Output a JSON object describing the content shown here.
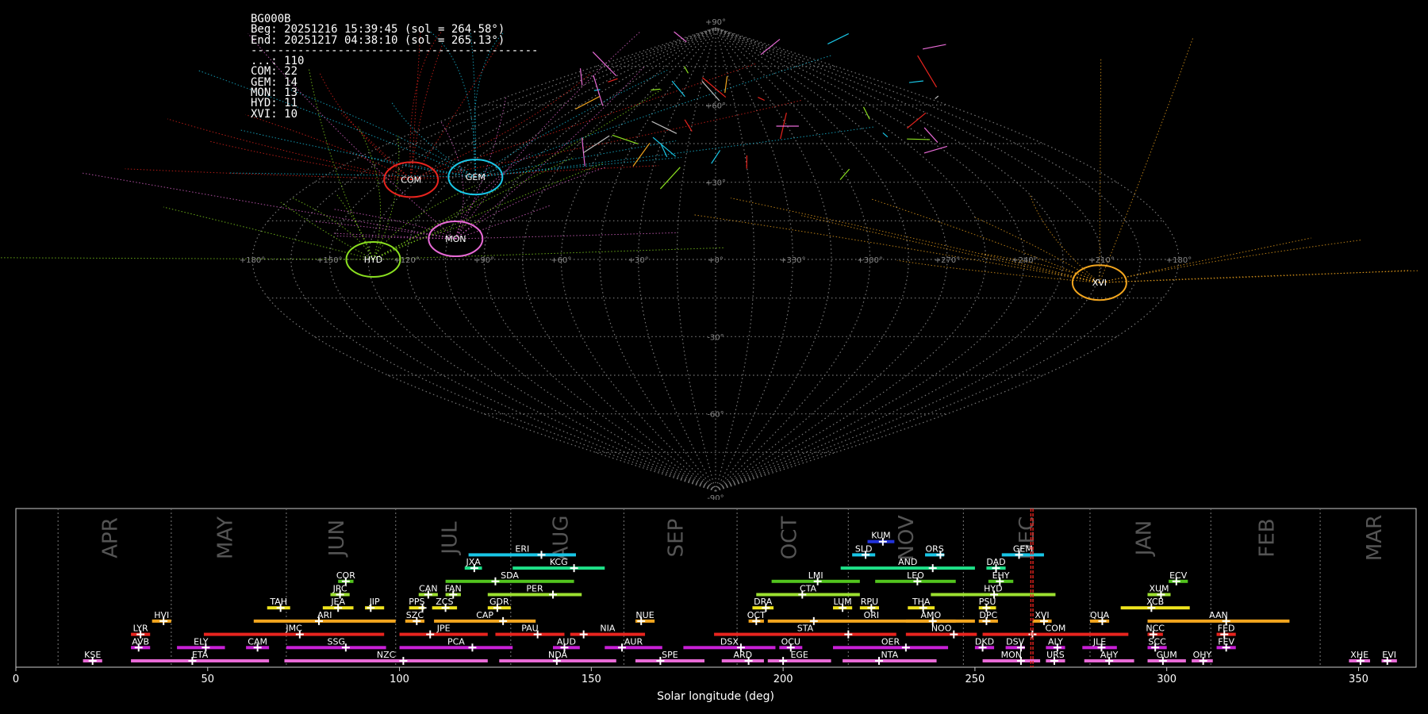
{
  "info": {
    "station": "BG000B",
    "begin": "Beg: 20251216 15:39:45 (sol = 264.58°)",
    "end": "End: 20251217 04:38:10 (sol = 265.13°)",
    "separator": "-------------------------------------------",
    "counts": [
      "...: 110",
      "COM: 22",
      "GEM: 14",
      "MON: 13",
      "HYD: 11",
      "XVI: 10"
    ]
  },
  "sky_map": {
    "projection": "sinusoidal",
    "center_lon": 0,
    "lon_ticks": [
      "+180°",
      "+150°",
      "+120°",
      "+90°",
      "+60°",
      "+30°",
      "+0°",
      "+330°",
      "+300°",
      "+270°",
      "+240°",
      "+210°",
      "+180°"
    ],
    "lat_ticks": [
      "+90°",
      "+60°",
      "+30°",
      "-30°",
      "-60°",
      "-90°"
    ],
    "radiants": [
      {
        "code": "COM",
        "lon": 138,
        "lat": 31,
        "color": "#e8241e"
      },
      {
        "code": "GEM",
        "lon": 110,
        "lat": 32,
        "color": "#19c6e6"
      },
      {
        "code": "MON",
        "lon": 102,
        "lat": 8,
        "color": "#e86ad6"
      },
      {
        "code": "HYD",
        "lon": 133,
        "lat": 0,
        "color": "#8be020"
      },
      {
        "code": "XVI",
        "lon": 209,
        "lat": -9,
        "color": "#f2a51e"
      }
    ]
  },
  "chart_data": {
    "type": "timeline",
    "xlabel": "Solar longitude (deg)",
    "xlim": [
      0,
      365
    ],
    "x_ticks": [
      0,
      50,
      100,
      150,
      200,
      250,
      300,
      350
    ],
    "current_sol": [
      264.58,
      265.13
    ],
    "month_boundaries": [
      11,
      40.5,
      70.5,
      99,
      129,
      158.5,
      188,
      217,
      247,
      280,
      311.5,
      340
    ],
    "months": [
      {
        "name": "APR",
        "x": 24.5
      },
      {
        "name": "MAY",
        "x": 54.5
      },
      {
        "name": "JUN",
        "x": 83.5
      },
      {
        "name": "JUL",
        "x": 113
      },
      {
        "name": "AUG",
        "x": 142
      },
      {
        "name": "SEP",
        "x": 172
      },
      {
        "name": "OCT",
        "x": 201.5
      },
      {
        "name": "NOV",
        "x": 232
      },
      {
        "name": "DEC",
        "x": 263.5
      },
      {
        "name": "JAN",
        "x": 294
      },
      {
        "name": "FEB",
        "x": 326
      },
      {
        "name": "MAR",
        "x": 354
      }
    ],
    "showers": [
      {
        "code": "KSE",
        "start": 17.5,
        "end": 22.5,
        "peak": 20,
        "row": 0,
        "color": "#e86ad6"
      },
      {
        "code": "ETA",
        "start": 30,
        "end": 66,
        "peak": 46,
        "row": 0,
        "color": "#e86ad6"
      },
      {
        "code": "NZC",
        "start": 70,
        "end": 123,
        "peak": 101,
        "row": 0,
        "color": "#e86ad6"
      },
      {
        "code": "NDA",
        "start": 126,
        "end": 156.5,
        "peak": 141,
        "row": 0,
        "color": "#e86ad6"
      },
      {
        "code": "SPE",
        "start": 161.5,
        "end": 179.5,
        "peak": 168,
        "row": 0,
        "color": "#e86ad6"
      },
      {
        "code": "ARD",
        "start": 184,
        "end": 195,
        "peak": 191,
        "row": 0,
        "color": "#e86ad6"
      },
      {
        "code": "EGE",
        "start": 196,
        "end": 212.5,
        "peak": 200,
        "row": 0,
        "color": "#e86ad6"
      },
      {
        "code": "NTA",
        "start": 215.5,
        "end": 240,
        "peak": 225,
        "row": 0,
        "color": "#e86ad6"
      },
      {
        "code": "MON",
        "start": 252,
        "end": 267,
        "peak": 262,
        "row": 0,
        "color": "#e86ad6"
      },
      {
        "code": "URS",
        "start": 268.5,
        "end": 273.5,
        "peak": 270.7,
        "row": 0,
        "color": "#e86ad6"
      },
      {
        "code": "AHY",
        "start": 278.5,
        "end": 291.5,
        "peak": 285,
        "row": 0,
        "color": "#e86ad6"
      },
      {
        "code": "GUM",
        "start": 295,
        "end": 305,
        "peak": 299,
        "row": 0,
        "color": "#e86ad6"
      },
      {
        "code": "OHY",
        "start": 306.5,
        "end": 312,
        "peak": 309.5,
        "row": 0,
        "color": "#e86ad6"
      },
      {
        "code": "XHE",
        "start": 347.5,
        "end": 353,
        "peak": 350.5,
        "row": 0,
        "color": "#e86ad6"
      },
      {
        "code": "EVI",
        "start": 356,
        "end": 360,
        "peak": 357.5,
        "row": 0,
        "color": "#e86ad6"
      },
      {
        "code": "AVB",
        "start": 30,
        "end": 35,
        "peak": 32,
        "row": 1,
        "color": "#c820d6"
      },
      {
        "code": "ELY",
        "start": 42,
        "end": 54.5,
        "peak": 49.5,
        "row": 1,
        "color": "#c820d6"
      },
      {
        "code": "CAM",
        "start": 60,
        "end": 66,
        "peak": 63,
        "row": 1,
        "color": "#c820d6"
      },
      {
        "code": "SSG",
        "start": 70.5,
        "end": 96.5,
        "peak": 86,
        "row": 1,
        "color": "#c820d6"
      },
      {
        "code": "PCA",
        "start": 100,
        "end": 129.5,
        "peak": 119,
        "row": 1,
        "color": "#c820d6"
      },
      {
        "code": "AUD",
        "start": 140,
        "end": 147,
        "peak": 143,
        "row": 1,
        "color": "#c820d6"
      },
      {
        "code": "AUR",
        "start": 153.5,
        "end": 168.5,
        "peak": 158,
        "row": 1,
        "color": "#c820d6"
      },
      {
        "code": "DSX",
        "start": 174,
        "end": 198,
        "peak": 189,
        "row": 1,
        "color": "#c820d6"
      },
      {
        "code": "OCU",
        "start": 199,
        "end": 205,
        "peak": 202,
        "row": 1,
        "color": "#c820d6"
      },
      {
        "code": "OER",
        "start": 213,
        "end": 243,
        "peak": 232,
        "row": 1,
        "color": "#c820d6"
      },
      {
        "code": "DKD",
        "start": 250,
        "end": 255,
        "peak": 252,
        "row": 1,
        "color": "#c820d6"
      },
      {
        "code": "DSV",
        "start": 258,
        "end": 263,
        "peak": 262,
        "row": 1,
        "color": "#c820d6"
      },
      {
        "code": "ALY",
        "start": 268.5,
        "end": 273.5,
        "peak": 271.5,
        "row": 1,
        "color": "#c820d6"
      },
      {
        "code": "JLE",
        "start": 278,
        "end": 287,
        "peak": 283,
        "row": 1,
        "color": "#c820d6"
      },
      {
        "code": "SCC",
        "start": 295,
        "end": 300,
        "peak": 297,
        "row": 1,
        "color": "#c820d6"
      },
      {
        "code": "FEV",
        "start": 313,
        "end": 318,
        "peak": 315.5,
        "row": 1,
        "color": "#c820d6"
      },
      {
        "code": "LYR",
        "start": 30,
        "end": 35,
        "peak": 32.5,
        "row": 2,
        "color": "#e8241e"
      },
      {
        "code": "JMC",
        "start": 49,
        "end": 96,
        "peak": 74,
        "row": 2,
        "color": "#e8241e"
      },
      {
        "code": "JPE",
        "start": 100,
        "end": 123,
        "peak": 108,
        "row": 2,
        "color": "#e8241e"
      },
      {
        "code": "PAU",
        "start": 125,
        "end": 143,
        "peak": 136,
        "row": 2,
        "color": "#e8241e"
      },
      {
        "code": "NIA",
        "start": 144.5,
        "end": 164,
        "peak": 148,
        "row": 2,
        "color": "#e8241e"
      },
      {
        "code": "STA",
        "start": 182,
        "end": 229.5,
        "peak": 217,
        "row": 2,
        "color": "#e8241e"
      },
      {
        "code": "NOO",
        "start": 232,
        "end": 250.5,
        "peak": 244.5,
        "row": 2,
        "color": "#e8241e"
      },
      {
        "code": "COM",
        "start": 252,
        "end": 290,
        "peak": 265,
        "row": 2,
        "color": "#e8241e"
      },
      {
        "code": "NCC",
        "start": 295,
        "end": 299,
        "peak": 296.5,
        "row": 2,
        "color": "#e8241e"
      },
      {
        "code": "FED",
        "start": 313,
        "end": 318,
        "peak": 315,
        "row": 2,
        "color": "#e8241e"
      },
      {
        "code": "HVI",
        "start": 35.5,
        "end": 40.5,
        "peak": 38.5,
        "row": 3,
        "color": "#f2a51e"
      },
      {
        "code": "ARI",
        "start": 62,
        "end": 99,
        "peak": 79,
        "row": 3,
        "color": "#f2a51e"
      },
      {
        "code": "SZC",
        "start": 101.5,
        "end": 106.5,
        "peak": 104.5,
        "row": 3,
        "color": "#f2a51e"
      },
      {
        "code": "CAP",
        "start": 109,
        "end": 135.5,
        "peak": 127,
        "row": 3,
        "color": "#f2a51e"
      },
      {
        "code": "NUE",
        "start": 161.5,
        "end": 166.5,
        "peak": 163,
        "row": 3,
        "color": "#f2a51e"
      },
      {
        "code": "OCT",
        "start": 191,
        "end": 195,
        "peak": 193,
        "row": 3,
        "color": "#f2a51e"
      },
      {
        "code": "ORI",
        "start": 196,
        "end": 250,
        "peak": 208,
        "row": 3,
        "color": "#f2a51e"
      },
      {
        "code": "AMO",
        "start": 232,
        "end": 245,
        "peak": 239,
        "row": 3,
        "color": "#f2a51e"
      },
      {
        "code": "DPC",
        "start": 251,
        "end": 256,
        "peak": 253,
        "row": 3,
        "color": "#f2a51e"
      },
      {
        "code": "XVI",
        "start": 265,
        "end": 270,
        "peak": 268,
        "row": 3,
        "color": "#f2a51e"
      },
      {
        "code": "QUA",
        "start": 280,
        "end": 285,
        "peak": 283.2,
        "row": 3,
        "color": "#f2a51e"
      },
      {
        "code": "AAN",
        "start": 295,
        "end": 332,
        "peak": 315.5,
        "row": 3,
        "color": "#f2a51e"
      },
      {
        "code": "TAH",
        "start": 65.5,
        "end": 71.5,
        "peak": 69,
        "row": 4,
        "color": "#f0e41e"
      },
      {
        "code": "JEA",
        "start": 80,
        "end": 88,
        "peak": 84,
        "row": 4,
        "color": "#f0e41e"
      },
      {
        "code": "JIP",
        "start": 91,
        "end": 96,
        "peak": 92.5,
        "row": 4,
        "color": "#f0e41e"
      },
      {
        "code": "PPS",
        "start": 102.5,
        "end": 106.5,
        "peak": 106,
        "row": 4,
        "color": "#f0e41e"
      },
      {
        "code": "ZCS",
        "start": 108.5,
        "end": 115,
        "peak": 112,
        "row": 4,
        "color": "#f0e41e"
      },
      {
        "code": "GDR",
        "start": 123,
        "end": 129,
        "peak": 125.5,
        "row": 4,
        "color": "#f0e41e"
      },
      {
        "code": "DRA",
        "start": 192,
        "end": 197.5,
        "peak": 195.5,
        "row": 4,
        "color": "#f0e41e"
      },
      {
        "code": "LUM",
        "start": 213,
        "end": 218,
        "peak": 215.5,
        "row": 4,
        "color": "#f0e41e"
      },
      {
        "code": "RPU",
        "start": 220,
        "end": 225,
        "peak": 223,
        "row": 4,
        "color": "#f0e41e"
      },
      {
        "code": "THA",
        "start": 232.5,
        "end": 239.5,
        "peak": 236.5,
        "row": 4,
        "color": "#f0e41e"
      },
      {
        "code": "PSU",
        "start": 251,
        "end": 255.5,
        "peak": 253,
        "row": 4,
        "color": "#f0e41e"
      },
      {
        "code": "XCB",
        "start": 288,
        "end": 306,
        "peak": 296,
        "row": 4,
        "color": "#f0e41e"
      },
      {
        "code": "JRC",
        "start": 82,
        "end": 87,
        "peak": 84.5,
        "row": 5,
        "color": "#9ce030"
      },
      {
        "code": "CAN",
        "start": 105,
        "end": 110,
        "peak": 107.5,
        "row": 5,
        "color": "#9ce030"
      },
      {
        "code": "FAN",
        "start": 112,
        "end": 116,
        "peak": 114,
        "row": 5,
        "color": "#9ce030"
      },
      {
        "code": "PER",
        "start": 123,
        "end": 147.5,
        "peak": 140,
        "row": 5,
        "color": "#9ce030"
      },
      {
        "code": "CTA",
        "start": 193,
        "end": 220,
        "peak": 205,
        "row": 5,
        "color": "#9ce030"
      },
      {
        "code": "HYD",
        "start": 238.5,
        "end": 271,
        "peak": 255,
        "row": 5,
        "color": "#9ce030"
      },
      {
        "code": "XUM",
        "start": 295,
        "end": 301,
        "peak": 298.5,
        "row": 5,
        "color": "#9ce030"
      },
      {
        "code": "COR",
        "start": 84,
        "end": 88,
        "peak": 86,
        "row": 6,
        "color": "#52c41e"
      },
      {
        "code": "SDA",
        "start": 112,
        "end": 145.5,
        "peak": 125,
        "row": 6,
        "color": "#52c41e"
      },
      {
        "code": "LMI",
        "start": 197,
        "end": 220,
        "peak": 209,
        "row": 6,
        "color": "#52c41e"
      },
      {
        "code": "LEO",
        "start": 224,
        "end": 245,
        "peak": 235,
        "row": 6,
        "color": "#52c41e"
      },
      {
        "code": "EHY",
        "start": 253.5,
        "end": 260,
        "peak": 256.5,
        "row": 6,
        "color": "#52c41e"
      },
      {
        "code": "ECV",
        "start": 300.5,
        "end": 305.5,
        "peak": 302.5,
        "row": 6,
        "color": "#52c41e"
      },
      {
        "code": "JXA",
        "start": 117,
        "end": 121.5,
        "peak": 119.5,
        "row": 7,
        "color": "#1ee088"
      },
      {
        "code": "KCG",
        "start": 129.5,
        "end": 153.5,
        "peak": 145.5,
        "row": 7,
        "color": "#1ee088"
      },
      {
        "code": "AND",
        "start": 215,
        "end": 250,
        "peak": 239,
        "row": 7,
        "color": "#1ee088"
      },
      {
        "code": "DAD",
        "start": 253,
        "end": 258,
        "peak": 255.5,
        "row": 7,
        "color": "#1ee088"
      },
      {
        "code": "ERI",
        "start": 118,
        "end": 146,
        "peak": 137,
        "row": 8,
        "color": "#19c6e6"
      },
      {
        "code": "SLD",
        "start": 218,
        "end": 224,
        "peak": 221.5,
        "row": 8,
        "color": "#19c6e6"
      },
      {
        "code": "ORS",
        "start": 237,
        "end": 242,
        "peak": 241,
        "row": 8,
        "color": "#19c6e6"
      },
      {
        "code": "GEM",
        "start": 257,
        "end": 268,
        "peak": 261.5,
        "row": 8,
        "color": "#19c6e6"
      },
      {
        "code": "KUM",
        "start": 222,
        "end": 229,
        "peak": 226,
        "row": 9,
        "color": "#2233dd"
      }
    ]
  }
}
